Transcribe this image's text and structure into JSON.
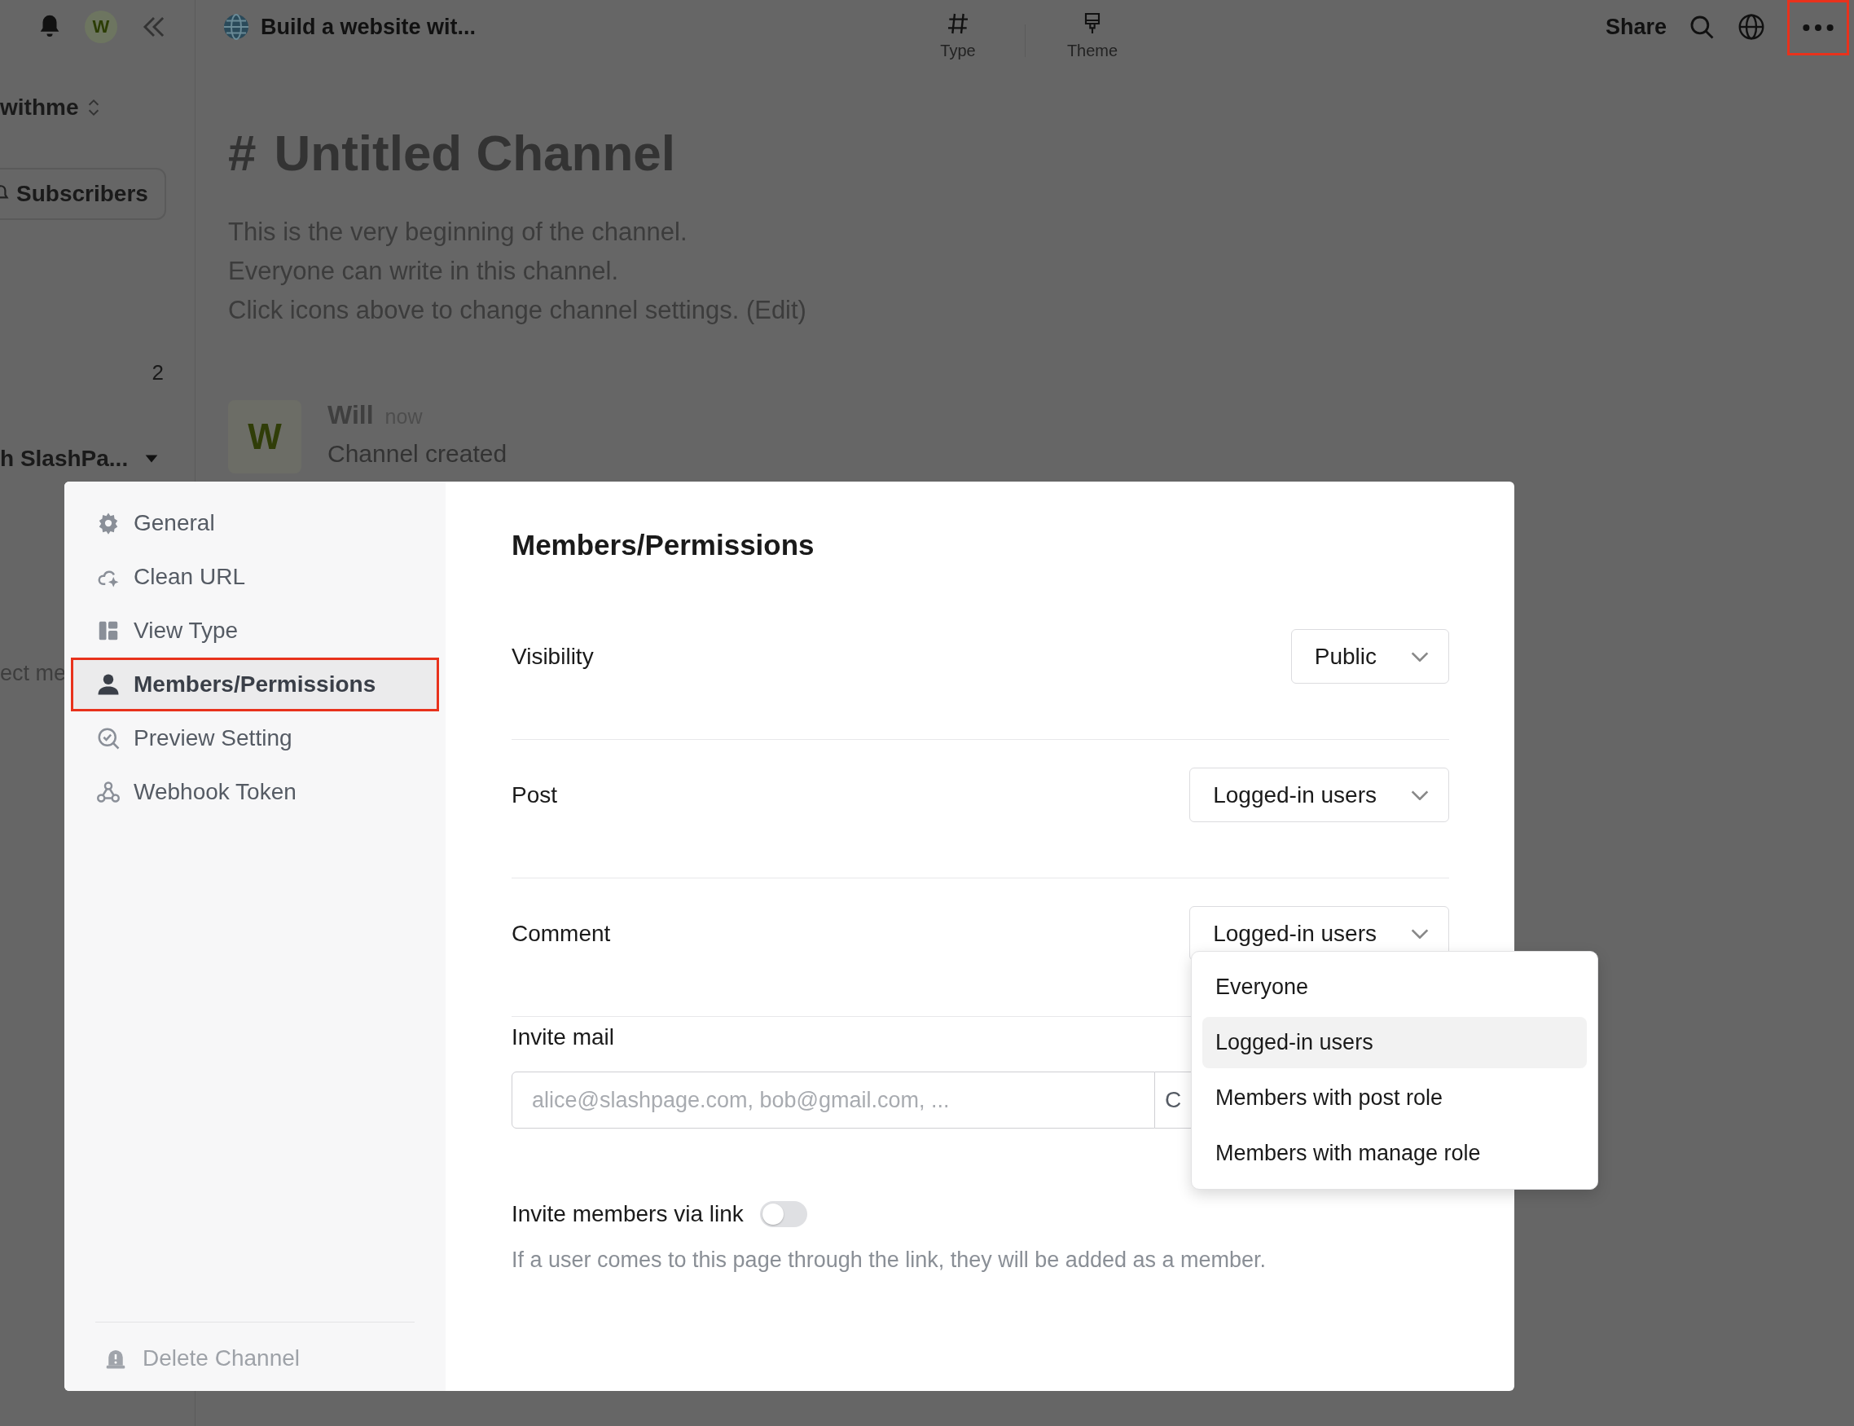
{
  "topbar": {
    "avatar": "W",
    "page_title": "Build a website wit...",
    "tools": [
      {
        "label": "Type"
      },
      {
        "label": "Theme"
      }
    ],
    "share": "Share",
    "more_marked": true
  },
  "sidebar": {
    "workspace": "withme",
    "subscribers": "Subscribers",
    "count": "2",
    "section": "h SlashPa...",
    "cut_item": "ect me"
  },
  "channel": {
    "hash": "#",
    "title": "Untitled Channel",
    "intro": [
      "This is the very beginning of the channel.",
      "Everyone can write in this channel.",
      "Click icons above to change channel settings. (Edit)"
    ],
    "message": {
      "avatar": "W",
      "author": "Will",
      "time": "now",
      "text": "Channel created"
    }
  },
  "settings": {
    "menu": [
      {
        "label": "General",
        "selected": false,
        "marked": false
      },
      {
        "label": "Clean URL",
        "selected": false,
        "marked": false
      },
      {
        "label": "View Type",
        "selected": false,
        "marked": false
      },
      {
        "label": "Members/Permissions",
        "selected": true,
        "marked": true
      },
      {
        "label": "Preview Setting",
        "selected": false,
        "marked": false
      },
      {
        "label": "Webhook Token",
        "selected": false,
        "marked": false
      }
    ],
    "delete": "Delete Channel",
    "title": "Members/Permissions",
    "rows": [
      {
        "label": "Visibility",
        "value": "Public"
      },
      {
        "label": "Post",
        "value": "Logged-in users"
      },
      {
        "label": "Comment",
        "value": "Logged-in users"
      }
    ],
    "invite_mail": {
      "label": "Invite mail",
      "placeholder": "alice@slashpage.com, bob@gmail.com, ...",
      "button": "C"
    },
    "invite_link": {
      "label": "Invite members via link",
      "on": false,
      "hint": "If a user comes to this page through the link, they will be added as a member."
    },
    "dropdown": {
      "options": [
        {
          "label": "Everyone",
          "selected": false
        },
        {
          "label": "Logged-in users",
          "selected": true
        },
        {
          "label": "Members with post role",
          "selected": false
        },
        {
          "label": "Members with manage role",
          "selected": false
        }
      ]
    }
  }
}
